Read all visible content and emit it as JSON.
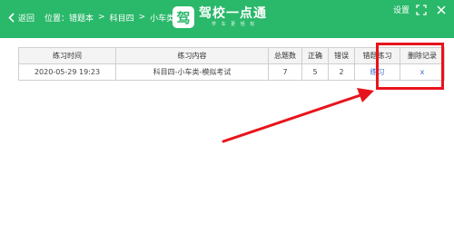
{
  "header": {
    "back_label": "返回",
    "breadcrumb": {
      "prefix": "位置：",
      "items": [
        "错题本",
        "科目四",
        "小车类"
      ],
      "separator": ">"
    },
    "logo": {
      "badge": "驾",
      "title": "驾校一点通",
      "slogan": "学 车 更 轻 松"
    },
    "settings_label": "设置"
  },
  "table": {
    "columns": [
      "练习时间",
      "练习内容",
      "总题数",
      "正确",
      "错误",
      "错题练习",
      "删除记录"
    ],
    "rows": [
      {
        "time": "2020-05-29 19:23",
        "content": "科目四-小车类-模拟考试",
        "total": "7",
        "correct": "5",
        "wrong": "2",
        "practice": "练习",
        "delete": "x"
      }
    ]
  },
  "colors": {
    "header_bg": "#2ab86a",
    "link": "#3a6cc8",
    "annotation": "#e8141b"
  },
  "icons": [
    "chevron-left-icon",
    "logo-icon",
    "expand-icon",
    "close-icon",
    "arrow-annotation"
  ]
}
